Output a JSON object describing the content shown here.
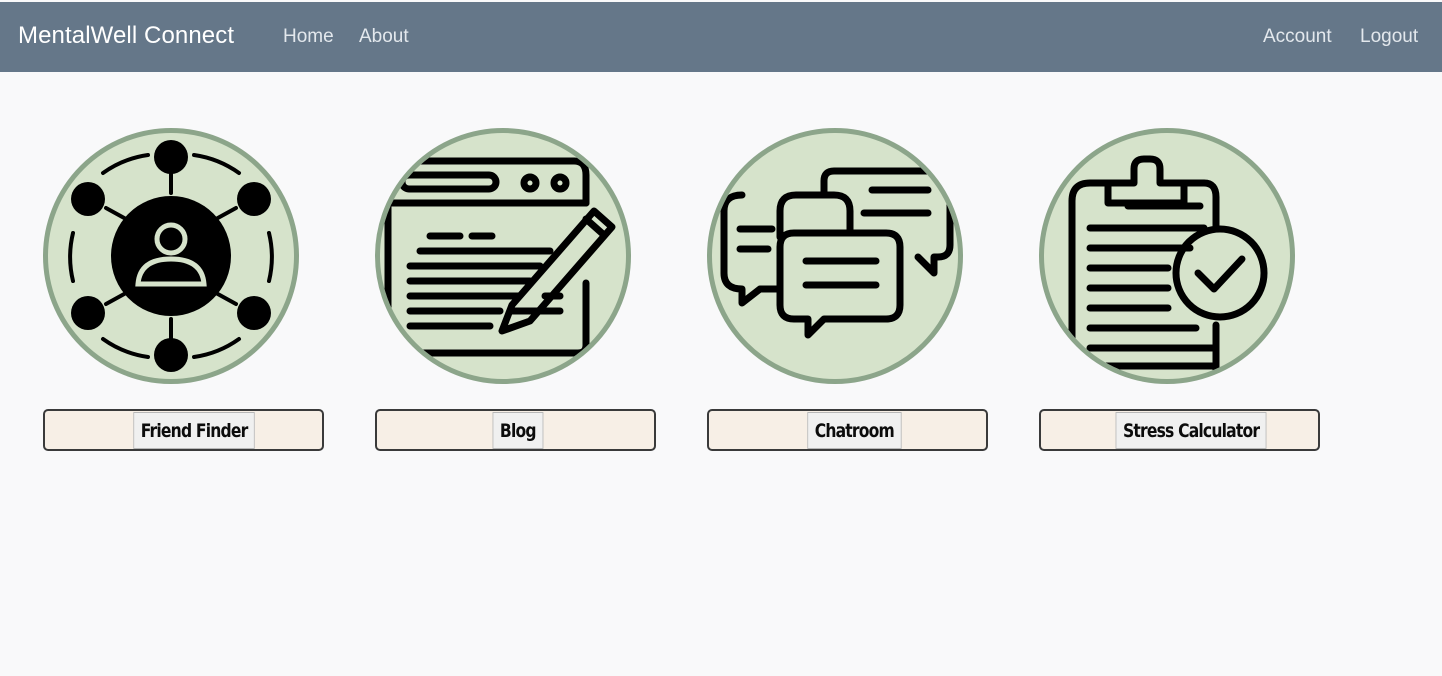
{
  "navbar": {
    "brand": "MentalWell Connect",
    "links_left": [
      "Home",
      "About"
    ],
    "links_right": [
      "Account",
      "Logout"
    ],
    "background": "#657789"
  },
  "features": [
    {
      "label": "Friend Finder",
      "icon": "network-person-icon"
    },
    {
      "label": "Blog",
      "icon": "browser-pencil-icon"
    },
    {
      "label": "Chatroom",
      "icon": "chat-bubbles-icon"
    },
    {
      "label": "Stress Calculator",
      "icon": "clipboard-check-icon"
    }
  ],
  "colors": {
    "circle_fill": "#d6e3cb",
    "circle_border": "#8ca58a",
    "label_box": "#f7efe6",
    "page_bg": "#f9f9fa"
  }
}
